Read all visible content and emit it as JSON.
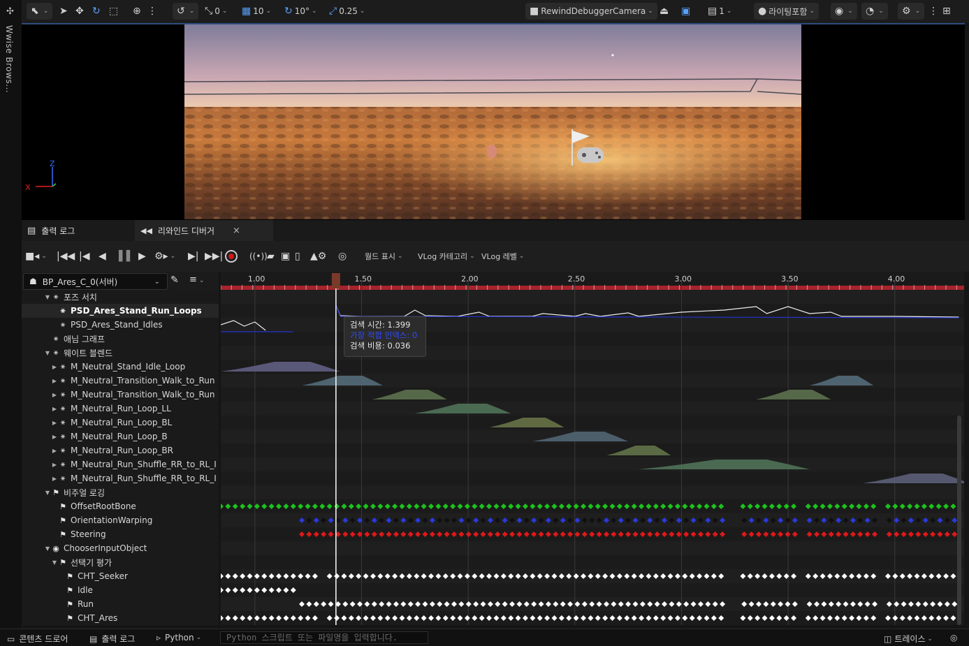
{
  "left_strip": {
    "tab_label": "Wwise Brows..."
  },
  "viewport_toolbar": {
    "snap_value": "0",
    "grid_value": "10",
    "rotation_value": "10°",
    "scale_value": "0.25",
    "camera_label": "RewindDebuggerCamera",
    "view_count": "1",
    "lighting_label": "라이팅포함"
  },
  "viewport": {
    "axis_z": "Z",
    "axis_x": "X"
  },
  "tabs": [
    {
      "label": "출력 로그",
      "icon": "output-log-icon"
    },
    {
      "label": "리와인드 디버거",
      "icon": "rewind-icon",
      "close": "×"
    }
  ],
  "transport": {
    "world_display": "월드 표시",
    "vlog_category": "VLog 카테고리",
    "vlog_level": "VLog 레벨"
  },
  "actor_selector": {
    "value": "BP_Ares_C_0(서버)"
  },
  "tree": [
    {
      "label": "포즈 서치",
      "depth": 1,
      "arrow": "down",
      "icon": "pose-search-icon"
    },
    {
      "label": "PSD_Ares_Stand_Run_Loops",
      "depth": 2,
      "arrow": "",
      "icon": "pose-search-icon",
      "selected": true
    },
    {
      "label": "PSD_Ares_Stand_Idles",
      "depth": 2,
      "arrow": "",
      "icon": "pose-search-icon"
    },
    {
      "label": "애님 그래프",
      "depth": 1,
      "arrow": "",
      "icon": "anim-graph-icon"
    },
    {
      "label": "웨이트 블렌드",
      "depth": 1,
      "arrow": "down",
      "icon": "blend-icon"
    },
    {
      "label": "M_Neutral_Stand_Idle_Loop",
      "depth": 2,
      "arrow": "right",
      "icon": "blend-icon"
    },
    {
      "label": "M_Neutral_Transition_Walk_to_Run",
      "depth": 2,
      "arrow": "right",
      "icon": "blend-icon"
    },
    {
      "label": "M_Neutral_Transition_Walk_to_Run",
      "depth": 2,
      "arrow": "right",
      "icon": "blend-icon"
    },
    {
      "label": "M_Neutral_Run_Loop_LL",
      "depth": 2,
      "arrow": "right",
      "icon": "blend-icon"
    },
    {
      "label": "M_Neutral_Run_Loop_BL",
      "depth": 2,
      "arrow": "right",
      "icon": "blend-icon"
    },
    {
      "label": "M_Neutral_Run_Loop_B",
      "depth": 2,
      "arrow": "right",
      "icon": "blend-icon"
    },
    {
      "label": "M_Neutral_Run_Loop_BR",
      "depth": 2,
      "arrow": "right",
      "icon": "blend-icon"
    },
    {
      "label": "M_Neutral_Run_Shuffle_RR_to_RL_I",
      "depth": 2,
      "arrow": "right",
      "icon": "blend-icon"
    },
    {
      "label": "M_Neutral_Run_Shuffle_RR_to_RL_I",
      "depth": 2,
      "arrow": "right",
      "icon": "blend-icon"
    },
    {
      "label": "비주얼 로깅",
      "depth": 1,
      "arrow": "down",
      "icon": "flag-icon"
    },
    {
      "label": "OffsetRootBone",
      "depth": 2,
      "arrow": "",
      "icon": "flag-icon"
    },
    {
      "label": "OrientationWarping",
      "depth": 2,
      "arrow": "",
      "icon": "flag-icon"
    },
    {
      "label": "Steering",
      "depth": 2,
      "arrow": "",
      "icon": "flag-icon"
    },
    {
      "label": "ChooserInputObject",
      "depth": 1,
      "arrow": "down",
      "icon": "chooser-icon"
    },
    {
      "label": "선택기 평가",
      "depth": 2,
      "arrow": "down",
      "icon": "flag-icon"
    },
    {
      "label": "CHT_Seeker",
      "depth": 3,
      "arrow": "",
      "icon": "flag-icon"
    },
    {
      "label": "Idle",
      "depth": 3,
      "arrow": "",
      "icon": "flag-icon"
    },
    {
      "label": "Run",
      "depth": 3,
      "arrow": "",
      "icon": "flag-icon"
    },
    {
      "label": "CHT_Ares",
      "depth": 3,
      "arrow": "",
      "icon": "flag-icon"
    }
  ],
  "timeline": {
    "ticks": [
      "1.00",
      "1.50",
      "2.00",
      "2.50",
      "3.00",
      "3.50",
      "4.00"
    ],
    "view_start": 0.84,
    "view_end": 4.325,
    "scrub_time": 1.38
  },
  "tooltip": {
    "search_time": "검색 시간: 1.399",
    "best_index": "가장 적합 인덱스: 0",
    "search_cost": "검색 비용: 0.036"
  },
  "bottom_bar": {
    "content_drawer": "콘텐츠 드로어",
    "output_log": "출력 로그",
    "python": "Python",
    "python_placeholder": "Python 스크립트 또는 파일명을 입력합니다.",
    "trace": "트레이스"
  },
  "colors": {
    "accent_blue": "#2e4d7a",
    "track_green": "#1cc21c",
    "track_red": "#e01818",
    "track_blue": "#2a3ad8",
    "playhead": "#ffffff",
    "ruler_red": "#a8232b"
  }
}
